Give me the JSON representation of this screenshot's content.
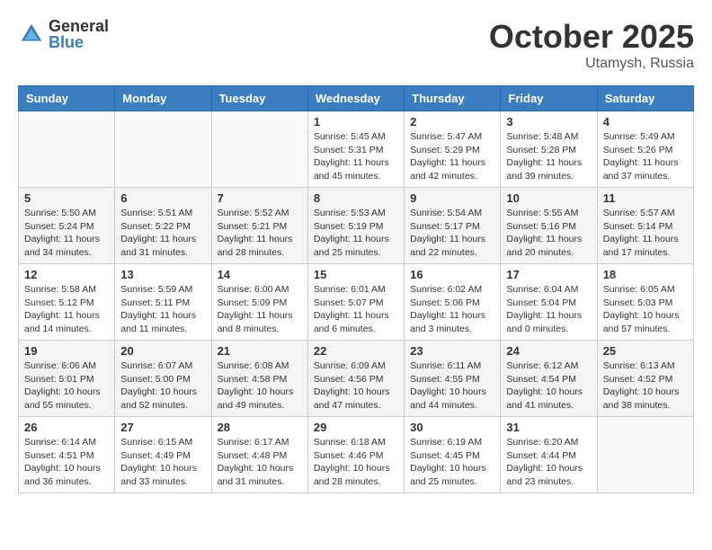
{
  "header": {
    "logo_general": "General",
    "logo_blue": "Blue",
    "month_title": "October 2025",
    "location": "Utamysh, Russia"
  },
  "days_of_week": [
    "Sunday",
    "Monday",
    "Tuesday",
    "Wednesday",
    "Thursday",
    "Friday",
    "Saturday"
  ],
  "weeks": [
    [
      {
        "day": "",
        "info": ""
      },
      {
        "day": "",
        "info": ""
      },
      {
        "day": "",
        "info": ""
      },
      {
        "day": "1",
        "info": "Sunrise: 5:45 AM\nSunset: 5:31 PM\nDaylight: 11 hours\nand 45 minutes."
      },
      {
        "day": "2",
        "info": "Sunrise: 5:47 AM\nSunset: 5:29 PM\nDaylight: 11 hours\nand 42 minutes."
      },
      {
        "day": "3",
        "info": "Sunrise: 5:48 AM\nSunset: 5:28 PM\nDaylight: 11 hours\nand 39 minutes."
      },
      {
        "day": "4",
        "info": "Sunrise: 5:49 AM\nSunset: 5:26 PM\nDaylight: 11 hours\nand 37 minutes."
      }
    ],
    [
      {
        "day": "5",
        "info": "Sunrise: 5:50 AM\nSunset: 5:24 PM\nDaylight: 11 hours\nand 34 minutes."
      },
      {
        "day": "6",
        "info": "Sunrise: 5:51 AM\nSunset: 5:22 PM\nDaylight: 11 hours\nand 31 minutes."
      },
      {
        "day": "7",
        "info": "Sunrise: 5:52 AM\nSunset: 5:21 PM\nDaylight: 11 hours\nand 28 minutes."
      },
      {
        "day": "8",
        "info": "Sunrise: 5:53 AM\nSunset: 5:19 PM\nDaylight: 11 hours\nand 25 minutes."
      },
      {
        "day": "9",
        "info": "Sunrise: 5:54 AM\nSunset: 5:17 PM\nDaylight: 11 hours\nand 22 minutes."
      },
      {
        "day": "10",
        "info": "Sunrise: 5:55 AM\nSunset: 5:16 PM\nDaylight: 11 hours\nand 20 minutes."
      },
      {
        "day": "11",
        "info": "Sunrise: 5:57 AM\nSunset: 5:14 PM\nDaylight: 11 hours\nand 17 minutes."
      }
    ],
    [
      {
        "day": "12",
        "info": "Sunrise: 5:58 AM\nSunset: 5:12 PM\nDaylight: 11 hours\nand 14 minutes."
      },
      {
        "day": "13",
        "info": "Sunrise: 5:59 AM\nSunset: 5:11 PM\nDaylight: 11 hours\nand 11 minutes."
      },
      {
        "day": "14",
        "info": "Sunrise: 6:00 AM\nSunset: 5:09 PM\nDaylight: 11 hours\nand 8 minutes."
      },
      {
        "day": "15",
        "info": "Sunrise: 6:01 AM\nSunset: 5:07 PM\nDaylight: 11 hours\nand 6 minutes."
      },
      {
        "day": "16",
        "info": "Sunrise: 6:02 AM\nSunset: 5:06 PM\nDaylight: 11 hours\nand 3 minutes."
      },
      {
        "day": "17",
        "info": "Sunrise: 6:04 AM\nSunset: 5:04 PM\nDaylight: 11 hours\nand 0 minutes."
      },
      {
        "day": "18",
        "info": "Sunrise: 6:05 AM\nSunset: 5:03 PM\nDaylight: 10 hours\nand 57 minutes."
      }
    ],
    [
      {
        "day": "19",
        "info": "Sunrise: 6:06 AM\nSunset: 5:01 PM\nDaylight: 10 hours\nand 55 minutes."
      },
      {
        "day": "20",
        "info": "Sunrise: 6:07 AM\nSunset: 5:00 PM\nDaylight: 10 hours\nand 52 minutes."
      },
      {
        "day": "21",
        "info": "Sunrise: 6:08 AM\nSunset: 4:58 PM\nDaylight: 10 hours\nand 49 minutes."
      },
      {
        "day": "22",
        "info": "Sunrise: 6:09 AM\nSunset: 4:56 PM\nDaylight: 10 hours\nand 47 minutes."
      },
      {
        "day": "23",
        "info": "Sunrise: 6:11 AM\nSunset: 4:55 PM\nDaylight: 10 hours\nand 44 minutes."
      },
      {
        "day": "24",
        "info": "Sunrise: 6:12 AM\nSunset: 4:54 PM\nDaylight: 10 hours\nand 41 minutes."
      },
      {
        "day": "25",
        "info": "Sunrise: 6:13 AM\nSunset: 4:52 PM\nDaylight: 10 hours\nand 38 minutes."
      }
    ],
    [
      {
        "day": "26",
        "info": "Sunrise: 6:14 AM\nSunset: 4:51 PM\nDaylight: 10 hours\nand 36 minutes."
      },
      {
        "day": "27",
        "info": "Sunrise: 6:15 AM\nSunset: 4:49 PM\nDaylight: 10 hours\nand 33 minutes."
      },
      {
        "day": "28",
        "info": "Sunrise: 6:17 AM\nSunset: 4:48 PM\nDaylight: 10 hours\nand 31 minutes."
      },
      {
        "day": "29",
        "info": "Sunrise: 6:18 AM\nSunset: 4:46 PM\nDaylight: 10 hours\nand 28 minutes."
      },
      {
        "day": "30",
        "info": "Sunrise: 6:19 AM\nSunset: 4:45 PM\nDaylight: 10 hours\nand 25 minutes."
      },
      {
        "day": "31",
        "info": "Sunrise: 6:20 AM\nSunset: 4:44 PM\nDaylight: 10 hours\nand 23 minutes."
      },
      {
        "day": "",
        "info": ""
      }
    ]
  ]
}
